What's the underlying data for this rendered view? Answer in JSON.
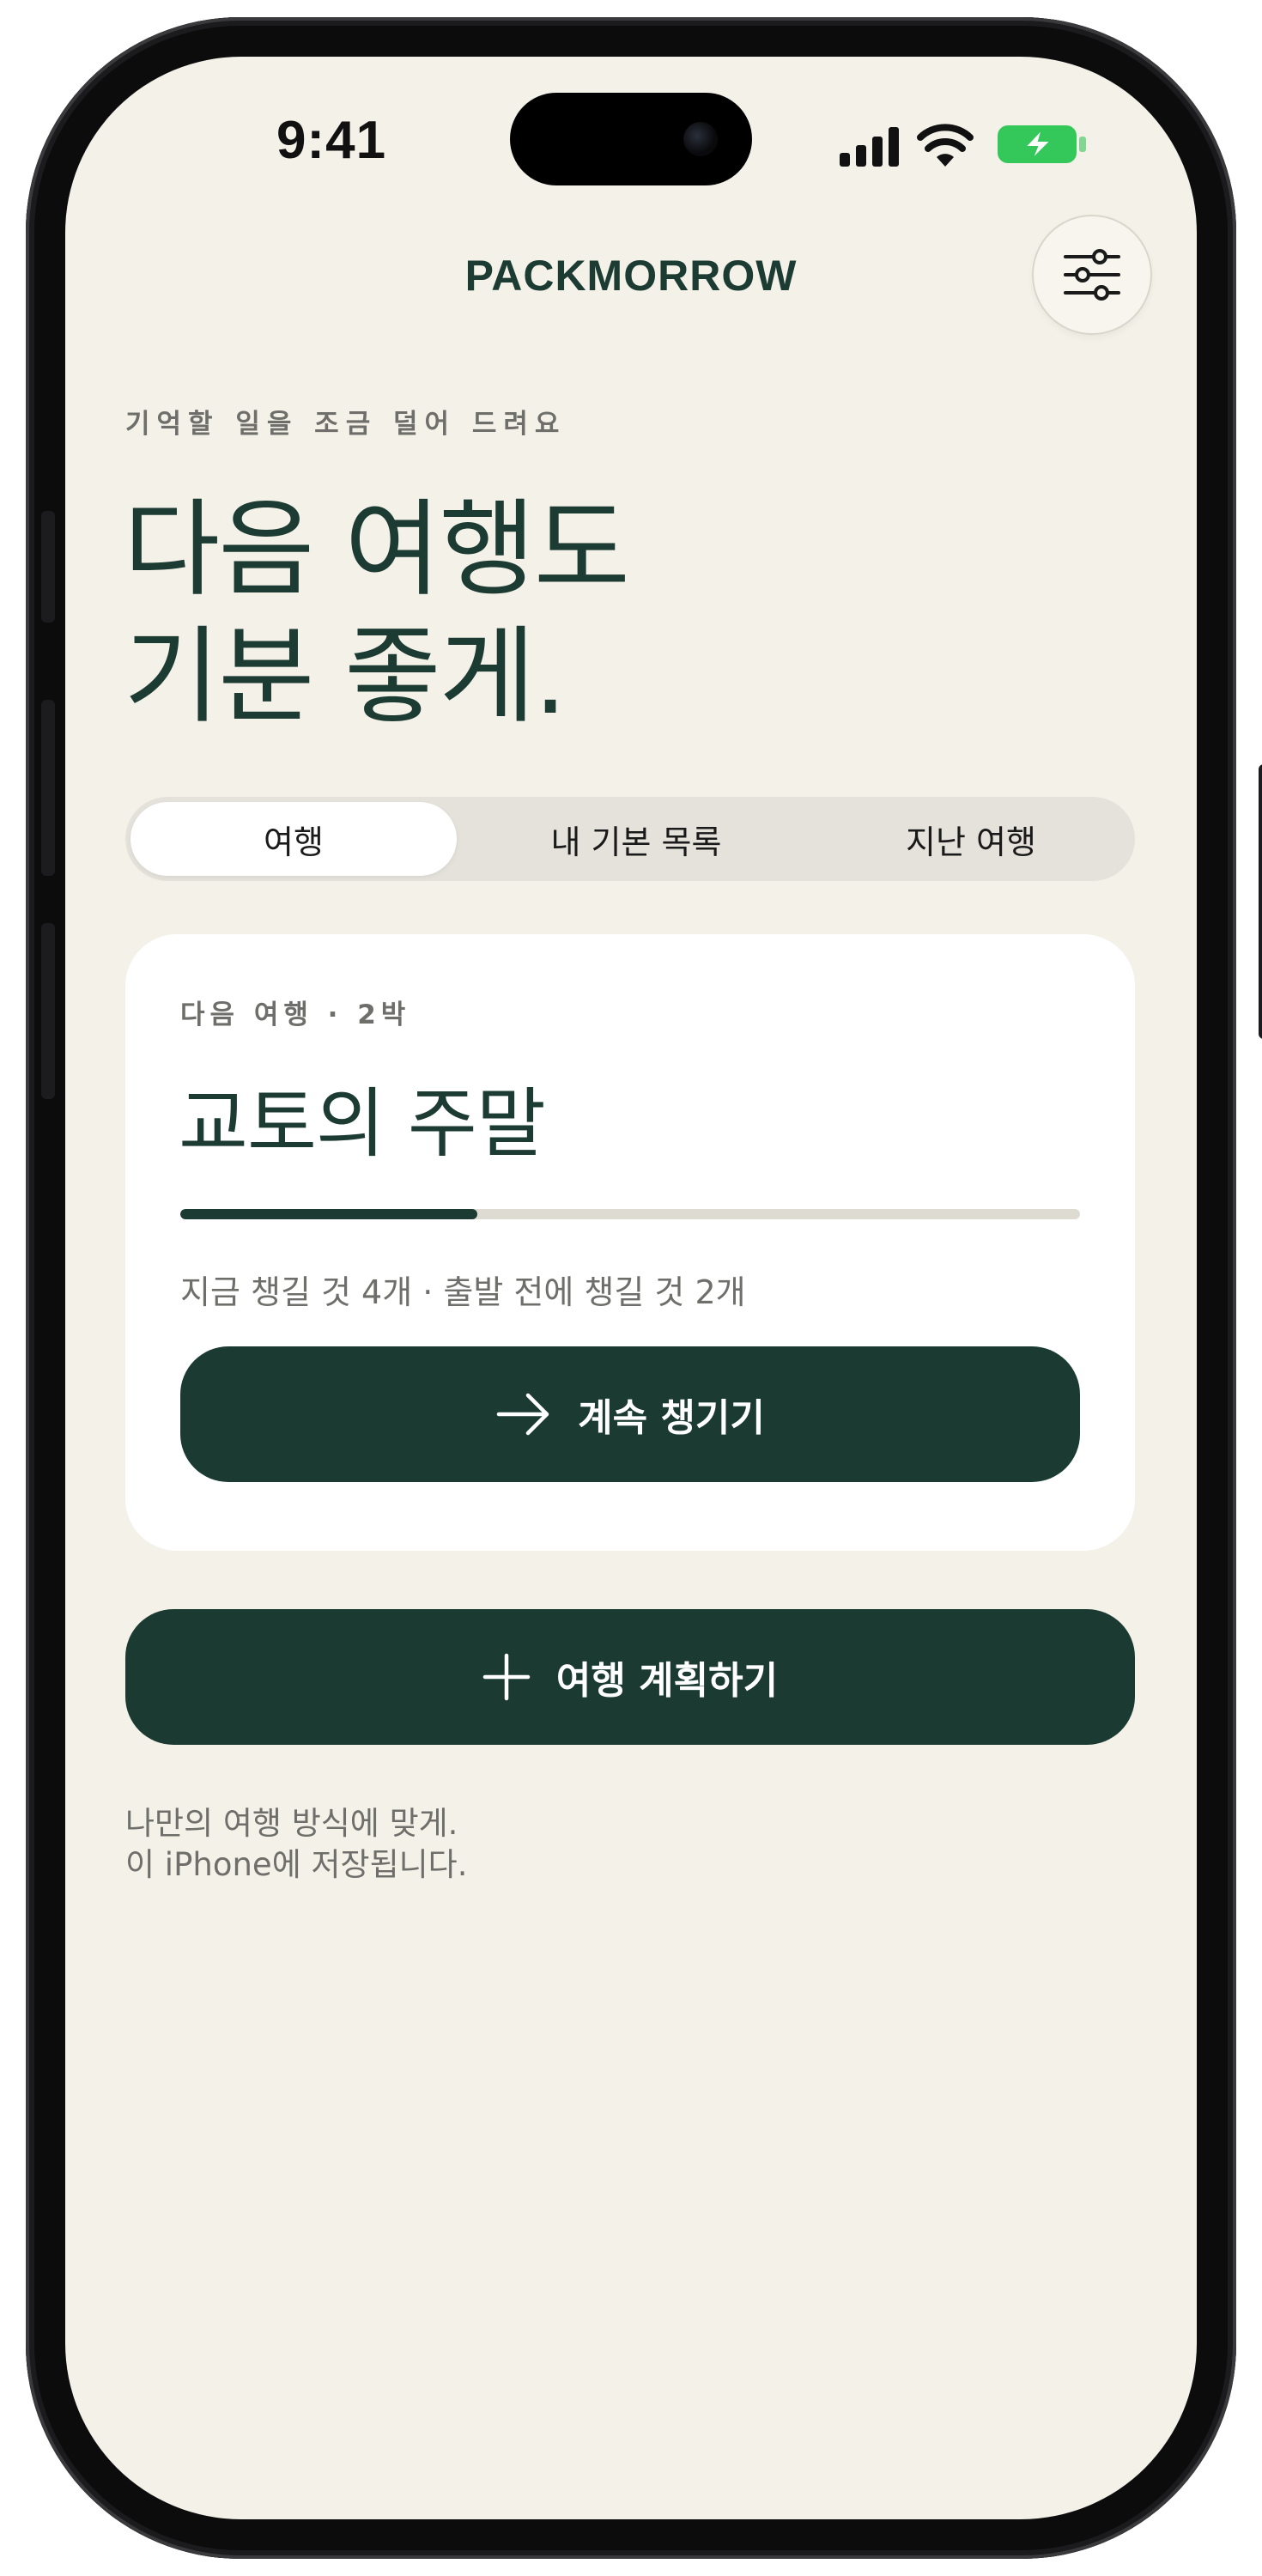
{
  "status_bar": {
    "time": "9:41"
  },
  "header": {
    "brand": "PACKMORROW",
    "settings_icon": "sliders-icon"
  },
  "hero": {
    "eyebrow": "기억할 일을 조금 덜어 드려요",
    "title_line1": "다음 여행도",
    "title_line2": "기분 좋게."
  },
  "tabs": [
    {
      "label": "여행",
      "selected": true
    },
    {
      "label": "내 기본 목록",
      "selected": false
    },
    {
      "label": "지난 여행",
      "selected": false
    }
  ],
  "trip_card": {
    "meta": "다음 여행 · 2박",
    "title": "교토의 주말",
    "progress": 0.33,
    "status": "지금 챙길 것 4개 · 출발 전에 챙길 것 2개",
    "continue_label": "계속 챙기기",
    "continue_icon": "arrow-right-icon"
  },
  "plan_button": {
    "label": "여행 계획하기",
    "icon": "plus-icon"
  },
  "footnote": {
    "line1": "나만의 여행 방식에 맞게.",
    "line2": "이 iPhone에 저장됩니다."
  },
  "colors": {
    "background": "#f4f1e8",
    "accent": "#1b3a32",
    "battery": "#34c759"
  }
}
